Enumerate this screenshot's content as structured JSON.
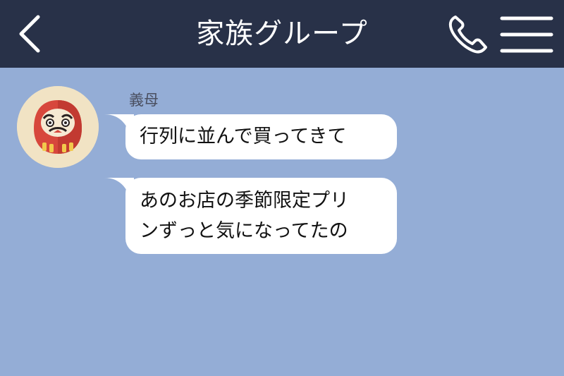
{
  "header": {
    "title": "家族グループ",
    "back_icon": "chevron-left-icon",
    "call_icon": "phone-icon",
    "menu_icon": "hamburger-menu-icon",
    "background_color": "#283148"
  },
  "chat": {
    "background_color": "#94ADD6",
    "messages": [
      {
        "sender": "義母",
        "avatar_icon": "daruma-icon",
        "text": "行列に並んで買ってきて"
      },
      {
        "sender": "義母",
        "text_lines": [
          "あのお店の季節限定プリ",
          "ンずっと気になってたの"
        ]
      }
    ]
  }
}
